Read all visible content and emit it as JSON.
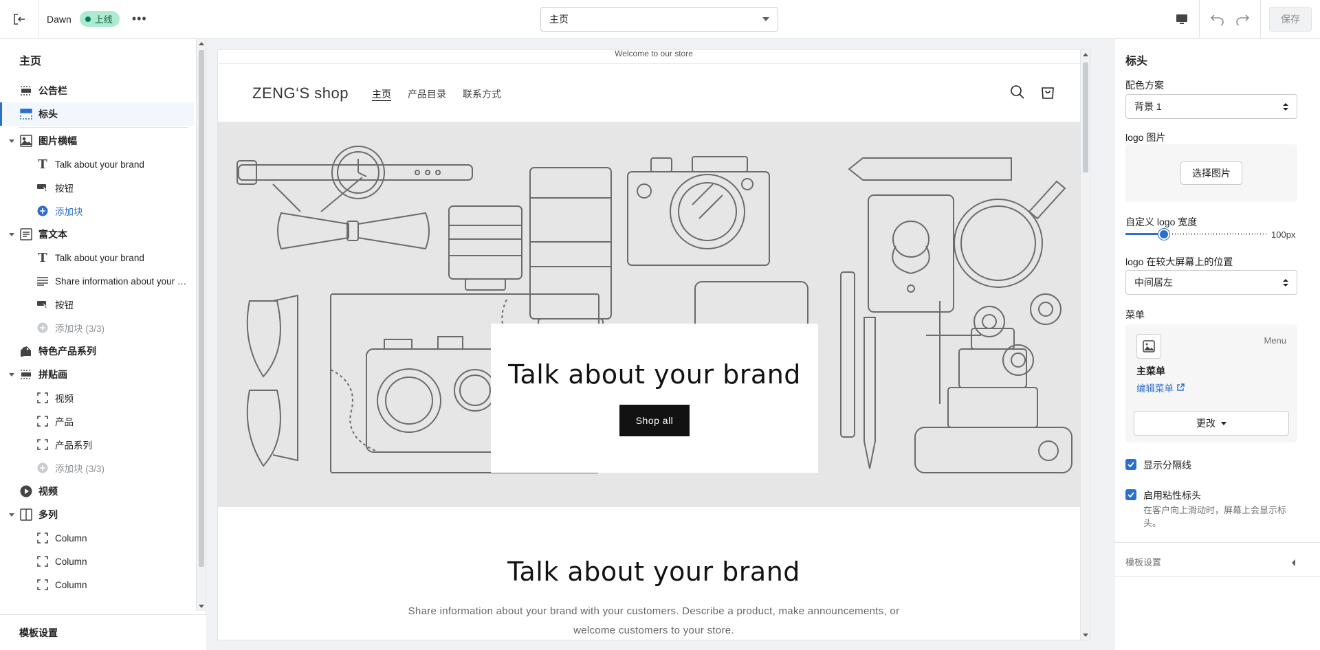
{
  "topbar": {
    "theme_name": "Dawn",
    "status_badge": "上线",
    "more": "•••",
    "page_select": "主页",
    "save_label": "保存"
  },
  "left": {
    "title": "主页",
    "items": {
      "announcement": "公告栏",
      "header": "标头",
      "image_banner": "图片横幅",
      "ib_heading": "Talk about your brand",
      "ib_button": "按钮",
      "ib_add": "添加块",
      "rich_text": "富文本",
      "rt_heading": "Talk about your brand",
      "rt_text": "Share information about your brand with your customers",
      "rt_button": "按钮",
      "rt_add": "添加块 (3/3)",
      "featured_collection": "特色产品系列",
      "collage": "拼贴画",
      "col_video": "视频",
      "col_product": "产品",
      "col_collection": "产品系列",
      "col_add": "添加块 (3/3)",
      "video": "视频",
      "multicolumn": "多列",
      "mc_col1": "Column",
      "mc_col2": "Column",
      "mc_col3": "Column"
    },
    "footer": "模板设置"
  },
  "preview": {
    "announcement": "Welcome to our store",
    "logo": "ZENG‘S shop",
    "nav": [
      "主页",
      "产品目录",
      "联系方式"
    ],
    "hero_heading": "Talk about your brand",
    "hero_button": "Shop all",
    "rich_heading": "Talk about your brand",
    "rich_text": "Share information about your brand with your customers. Describe a product, make announcements, or welcome customers to your store."
  },
  "right": {
    "title": "标头",
    "color_scheme_label": "配色方案",
    "color_scheme_value": "背景 1",
    "logo_image_label": "logo 图片",
    "select_image_button": "选择图片",
    "logo_width_label": "自定义 logo 宽度",
    "logo_width_value": "100px",
    "logo_width_fraction": 0.27,
    "logo_position_label": "logo 在较大屏幕上的位置",
    "logo_position_value": "中间居左",
    "menu_label": "菜单",
    "menu_tag": "Menu",
    "menu_name": "主菜单",
    "menu_edit": "编辑菜单",
    "menu_change": "更改",
    "show_divider": "显示分隔线",
    "sticky_header": "启用粘性标头",
    "sticky_help": "在客户向上滑动时，屏幕上会显示标头。",
    "footer": "模板设置"
  },
  "colors": {
    "accent": "#2c6ecb",
    "live_badge": "#aee9d1",
    "hero_bg": "#e6e6e6",
    "button_dark": "#121212"
  }
}
